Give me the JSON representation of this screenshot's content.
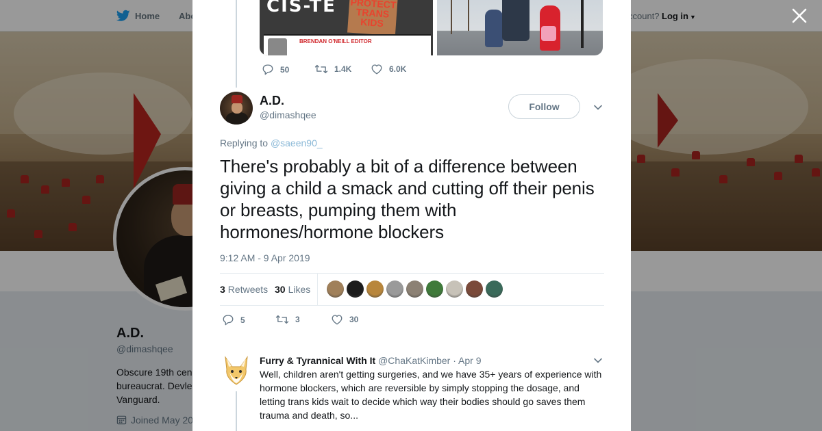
{
  "background_page": {
    "nav": {
      "home": "Home",
      "about": "Abo",
      "account_question": "ccount?",
      "login": "Log in"
    },
    "profile": {
      "name": "A.D.",
      "handle": "@dimashqee",
      "bio": [
        "Obscure 19th cen",
        "bureaucrat. Devle",
        "Vanguard."
      ],
      "joined": "Joined May 20"
    }
  },
  "modal": {
    "close_icon": "close-icon",
    "parent_tweet": {
      "media": {
        "image1_sign": "PROTECT TRANS KIDS",
        "image1_card_text": "BRENDAN O'NEILL EDITOR",
        "image1_banner_text": "CIS-TE"
      },
      "actions": {
        "replies": "50",
        "retweets": "1.4K",
        "likes": "6.0K"
      }
    },
    "tweet": {
      "name": "A.D.",
      "handle": "@dimashqee",
      "follow_label": "Follow",
      "replying_prefix": "Replying to",
      "replying_to": "@saeen90_",
      "text": "There's probably a bit of a difference between giving a child a smack and cutting off their penis or breasts, pumping them with hormones/hormone blockers",
      "timestamp": "9:12 AM - 9 Apr 2019",
      "retweets_count": "3",
      "retweets_label": "Retweets",
      "likes_count": "30",
      "likes_label": "Likes",
      "liker_avatar_colors": [
        "#a0805a",
        "#1c1c1c",
        "#b8863c",
        "#9a9a9a",
        "#8c8174",
        "#3f7a3a",
        "#c7c2b8",
        "#7a4a3a",
        "#3a6a5a"
      ],
      "actions": {
        "replies": "5",
        "retweets": "3",
        "likes": "30"
      }
    },
    "reply": {
      "name": "Furry & Tyrannical With It",
      "handle": "@ChaKatKimber",
      "separator": "·",
      "date": "Apr 9",
      "text": "Well, children aren't getting surgeries, and we have 35+ years of experience with hormone blockers, which are reversible by simply stopping the dosage, and letting trans kids wait to decide which way their bodies should go saves them trauma and death, so..."
    }
  },
  "colors": {
    "twitter_blue": "#1da1f2",
    "text_primary": "#14171a",
    "text_secondary": "#657786",
    "link_muted": "#8ab8d7"
  }
}
